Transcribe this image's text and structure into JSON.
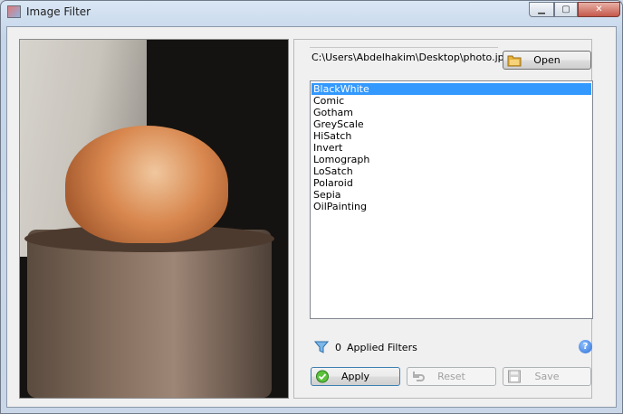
{
  "window": {
    "title": "Image Filter",
    "controls": {
      "minimize": "▁",
      "maximize": "▢",
      "close": "✕"
    }
  },
  "file": {
    "path": "C:\\Users\\Abdelhakim\\Desktop\\photo.jpg",
    "open_label": "Open"
  },
  "filters": {
    "items": [
      "BlackWhite",
      "Comic",
      "Gotham",
      "GreyScale",
      "HiSatch",
      "Invert",
      "Lomograph",
      "LoSatch",
      "Polaroid",
      "Sepia",
      "OilPainting"
    ],
    "selected": "BlackWhite"
  },
  "status": {
    "count": "0",
    "label": "Applied Filters"
  },
  "actions": {
    "apply_label": "Apply",
    "reset_label": "Reset",
    "save_label": "Save"
  },
  "icons": {
    "open": "folder-icon",
    "apply": "check-icon",
    "reset": "undo-icon",
    "save": "floppy-icon",
    "filter": "funnel-icon",
    "help": "help-icon"
  },
  "colors": {
    "selection": "#3399ff",
    "help": "#2f6fd6",
    "apply_check": "#3aa12a"
  }
}
